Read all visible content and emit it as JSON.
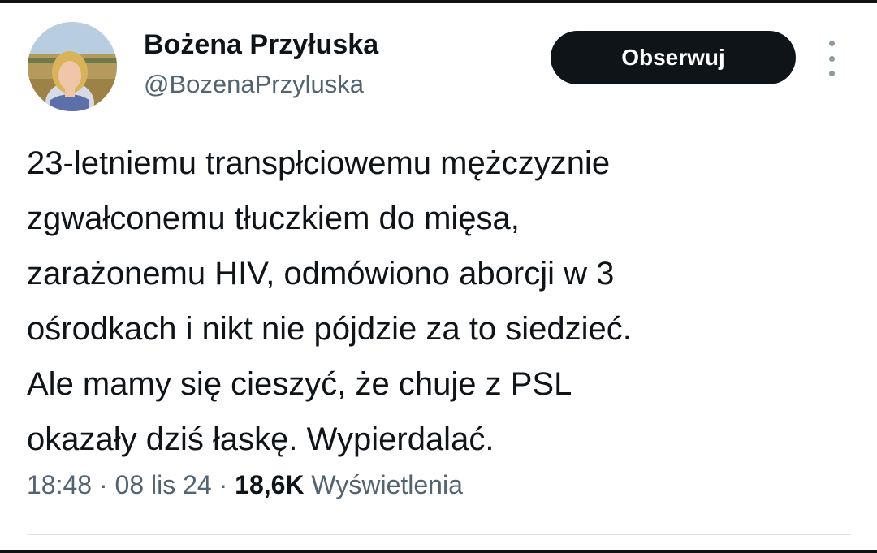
{
  "author": {
    "display_name": "Bożena Przyłuska",
    "handle": "@BozenaPrzyluska",
    "avatar": "profile-photo"
  },
  "actions": {
    "follow_label": "Obserwuj",
    "more_icon": "vertical-ellipsis-icon"
  },
  "tweet": {
    "lines": [
      "23-letniemu transpłciowemu mężczyznie",
      "zgwałconemu tłuczkiem do mięsa,",
      "zarażonemu HIV, odmówiono aborcji w 3",
      "ośrodkach i nikt nie pójdzie za to siedzieć.",
      "Ale mamy się cieszyć, że chuje z PSL",
      "okazały dziś łaskę. Wypierdalać."
    ]
  },
  "meta": {
    "time": "18:48",
    "separator": " · ",
    "date": "08 lis 24",
    "views_count": "18,6K",
    "views_label": "Wyświetlenia"
  },
  "colors": {
    "text": "#0f1419",
    "secondary_text": "#536471",
    "button_bg": "#0f1419",
    "button_text": "#ffffff"
  }
}
